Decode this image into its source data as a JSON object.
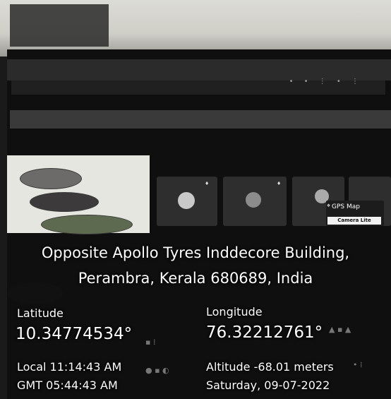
{
  "photo": {
    "gps_badge": {
      "title": "GPS Map",
      "subtitle": "Camera Lite",
      "pin_icon": "map-pin-icon"
    },
    "address": {
      "line1": "Opposite Apollo Tyres Inddecore Building,",
      "line2": "Perambra, Kerala 680689, India"
    },
    "latitude": {
      "label": "Latitude",
      "value": "10.34774534°"
    },
    "longitude": {
      "label": "Longitude",
      "value": "76.32212761°"
    },
    "local_time": "Local 11:14:43 AM",
    "gmt_time": "GMT 05:44:43 AM",
    "altitude": "Altitude -68.01 meters",
    "date": "Saturday, 09-07-2022"
  }
}
